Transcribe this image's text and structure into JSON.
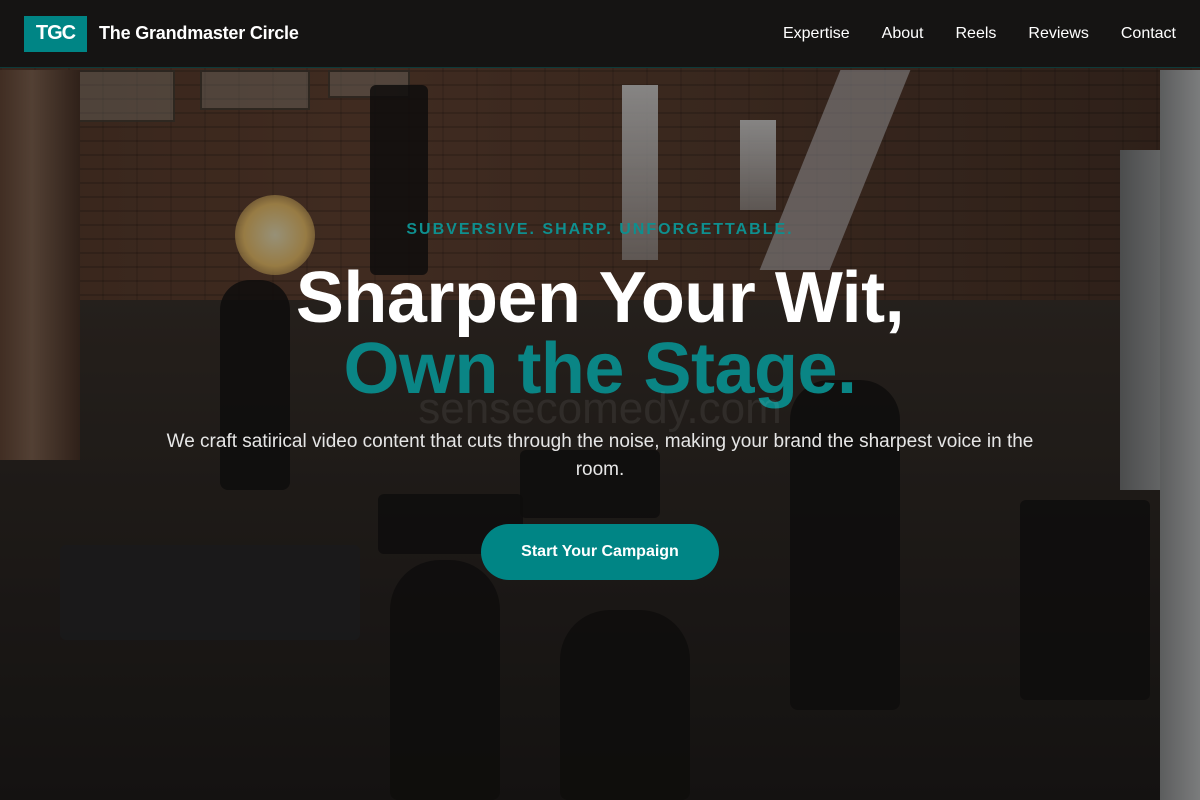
{
  "nav": {
    "logo_text": "TGC",
    "brand_name": "The Grandmaster Circle",
    "links": [
      "Expertise",
      "About",
      "Reels",
      "Reviews",
      "Contact"
    ]
  },
  "hero": {
    "tagline": "SUBVERSIVE. SHARP. UNFORGETTABLE.",
    "headline_line1": "Sharpen Your Wit,",
    "headline_line2": "Own the Stage.",
    "watermark": "sensecomedy.com",
    "subtitle": "We craft satirical video content that cuts through the noise, making your brand the sharpest voice in the room.",
    "cta_label": "Start Your Campaign",
    "background_description_icon": "film-set-photo"
  },
  "colors": {
    "accent": "#008585",
    "nav_bg": "#121212",
    "text": "#ffffff"
  }
}
